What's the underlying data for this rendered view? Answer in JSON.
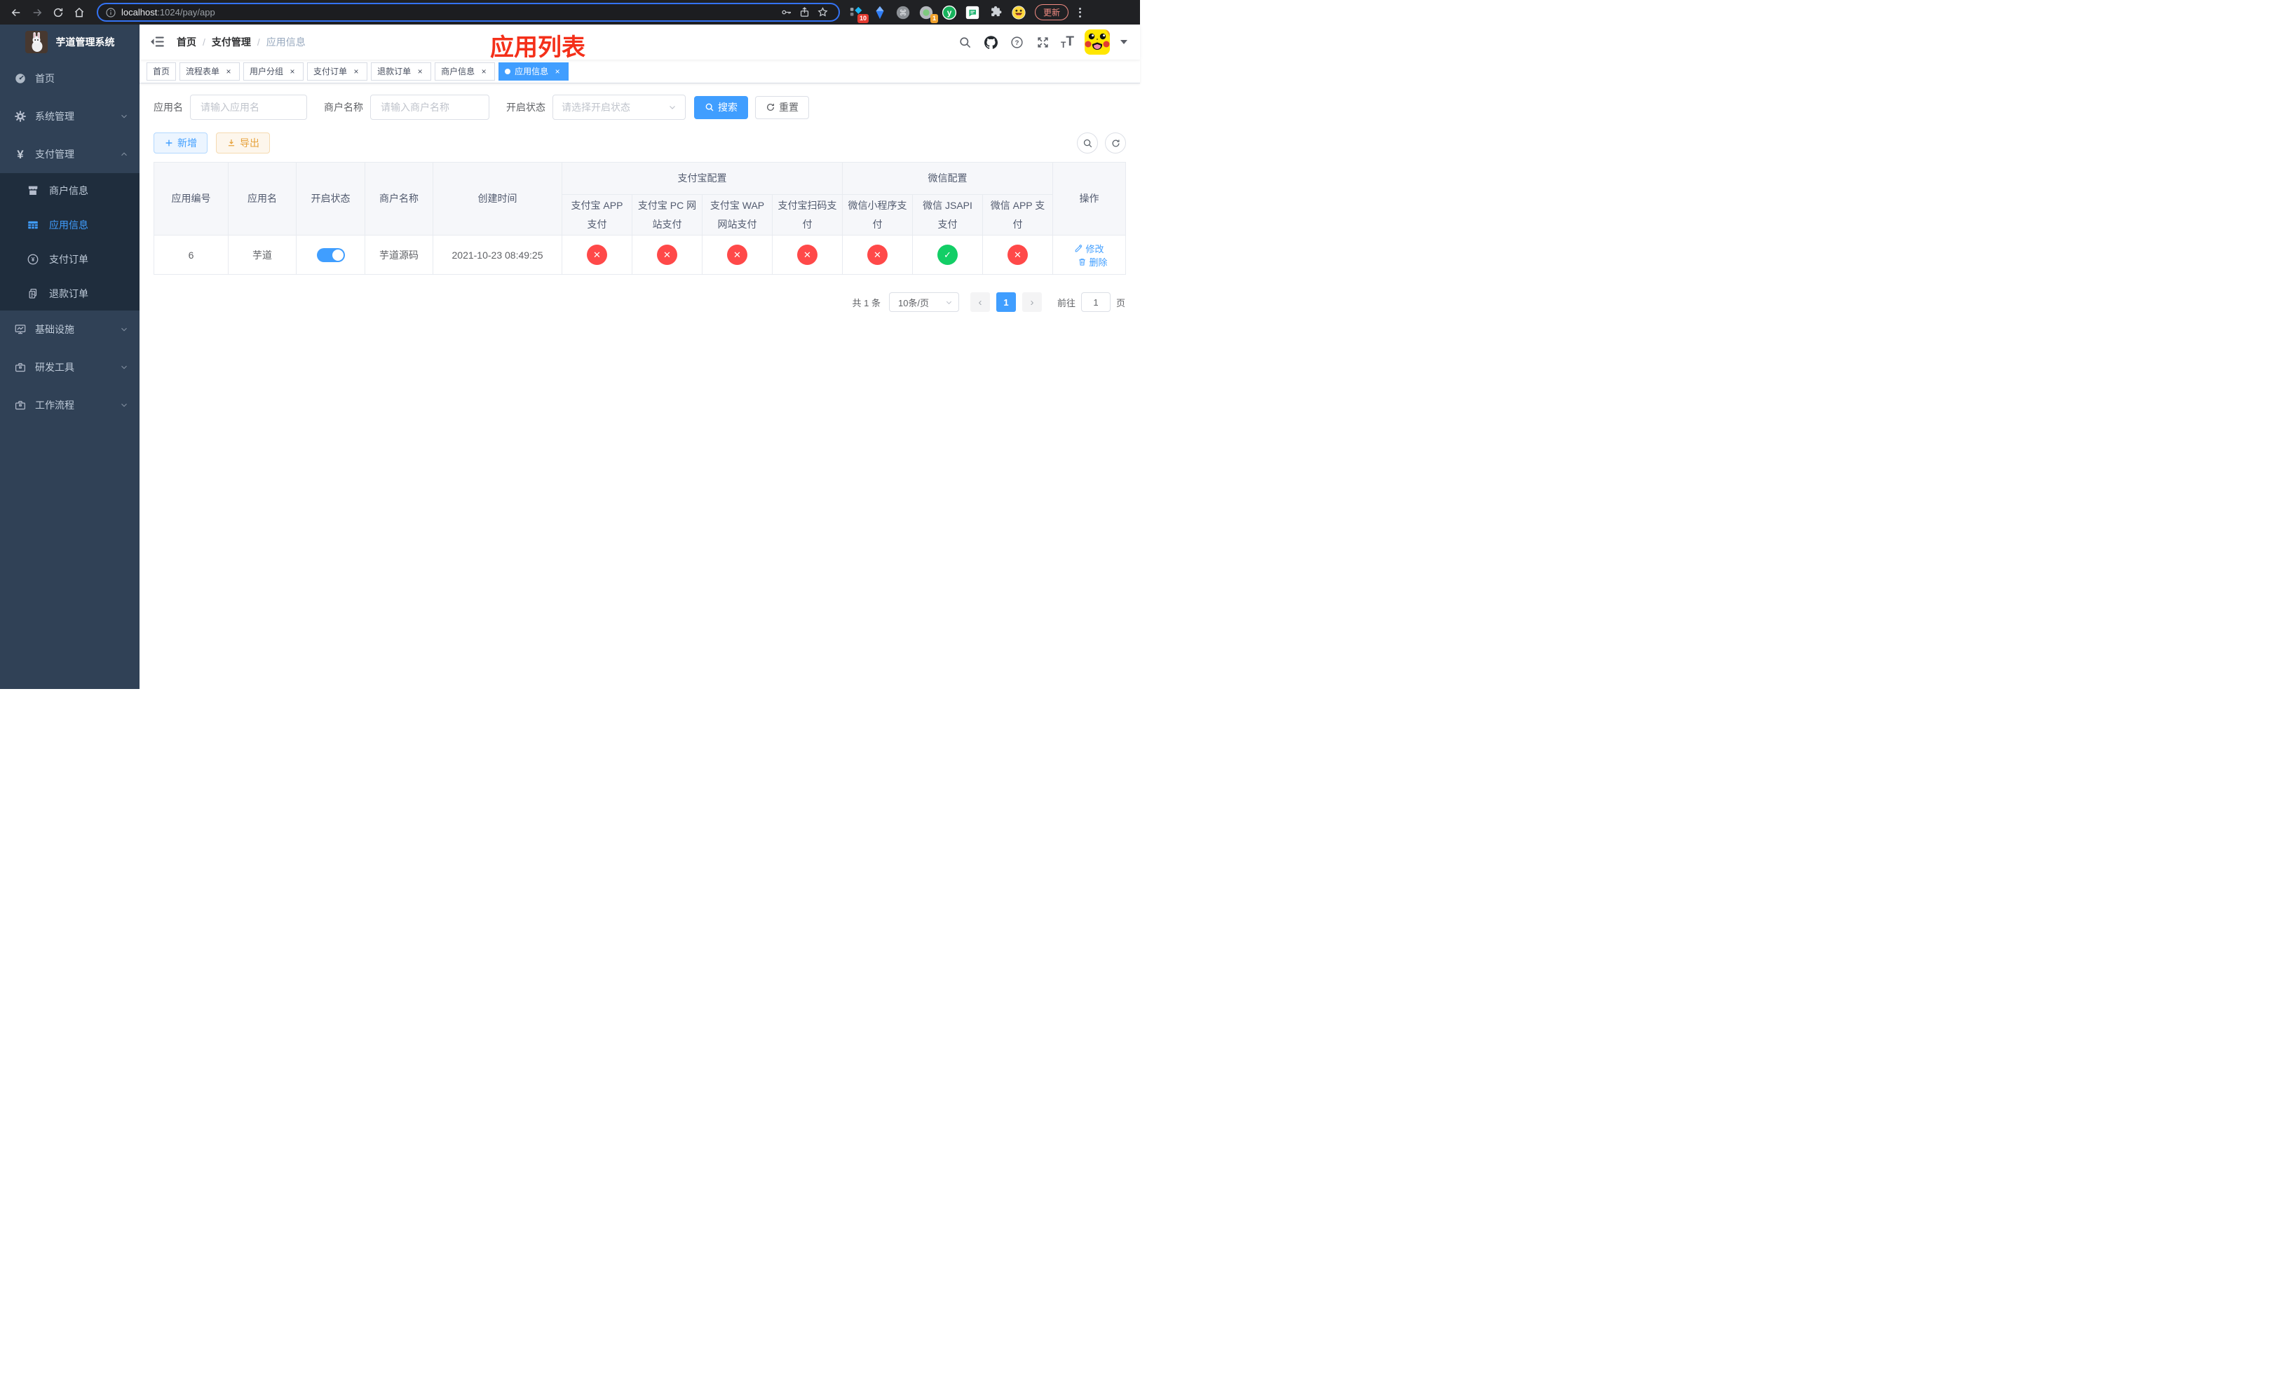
{
  "browser": {
    "url_host": "localhost",
    "url_rest": ":1024/pay/app",
    "ext_badge_blue": "10",
    "ext_badge_green": "1",
    "update_label": "更新"
  },
  "icons": {
    "slash": "/",
    "close": "×",
    "yen": "¥",
    "cmd": "⌘",
    "question": "?",
    "fail": "✕",
    "success": "✓",
    "prev": "‹",
    "next": "›",
    "letter_t": "T",
    "letter_y": "y"
  },
  "sidebar": {
    "title": "芋道管理系统",
    "home": "首页",
    "system": "系统管理",
    "payment": "支付管理",
    "sub_merchant": "商户信息",
    "sub_app": "应用信息",
    "sub_order": "支付订单",
    "sub_refund": "退款订单",
    "infra": "基础设施",
    "devtool": "研发工具",
    "workflow": "工作流程"
  },
  "navbar": {
    "breadcrumb": [
      "首页",
      "支付管理",
      "应用信息"
    ],
    "annotation": "应用列表"
  },
  "tabs": [
    {
      "label": "首页",
      "closable": false,
      "active": false
    },
    {
      "label": "流程表单",
      "closable": true,
      "active": false
    },
    {
      "label": "用户分组",
      "closable": true,
      "active": false
    },
    {
      "label": "支付订单",
      "closable": true,
      "active": false
    },
    {
      "label": "退款订单",
      "closable": true,
      "active": false
    },
    {
      "label": "商户信息",
      "closable": true,
      "active": false
    },
    {
      "label": "应用信息",
      "closable": true,
      "active": true
    }
  ],
  "filters": {
    "app_name_label": "应用名",
    "app_name_placeholder": "请输入应用名",
    "merchant_label": "商户名称",
    "merchant_placeholder": "请输入商户名称",
    "status_label": "开启状态",
    "status_placeholder": "请选择开启状态",
    "search_label": "搜索",
    "reset_label": "重置"
  },
  "toolbar": {
    "add_label": "新增",
    "export_label": "导出"
  },
  "table": {
    "headers": {
      "app_id": "应用编号",
      "app_name": "应用名",
      "status": "开启状态",
      "merchant": "商户名称",
      "create_time": "创建时间",
      "alipay_group": "支付宝配置",
      "wechat_group": "微信配置",
      "actions": "操作",
      "pay_cols": [
        "支付宝 APP 支付",
        "支付宝 PC 网站支付",
        "支付宝 WAP 网站支付",
        "支付宝扫码支付",
        "微信小程序支付",
        "微信 JSAPI 支付",
        "微信 APP 支付"
      ]
    },
    "row": {
      "app_id": "6",
      "app_name": "芋道",
      "status": "on",
      "merchant": "芋道源码",
      "create_time": "2021-10-23 08:49:25",
      "pay_statuses": [
        "fail",
        "fail",
        "fail",
        "fail",
        "fail",
        "success",
        "fail"
      ],
      "edit_label": "修改",
      "delete_label": "删除"
    }
  },
  "pagination": {
    "total": "共 1 条",
    "page_size": "10条/页",
    "page": "1",
    "goto_label": "前往",
    "goto_value": "1",
    "page_unit": "页"
  }
}
